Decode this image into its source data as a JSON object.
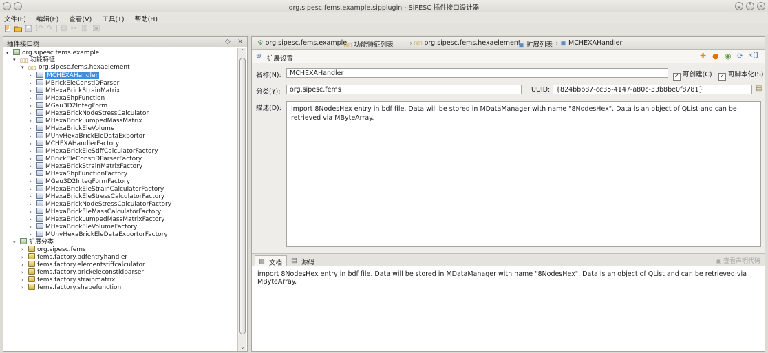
{
  "window": {
    "title": "org.sipesc.fems.example.sipplugin - SiPESC 插件接口设计器"
  },
  "menu": [
    "文件(F)",
    "编辑(E)",
    "查看(V)",
    "工具(T)",
    "帮助(H)"
  ],
  "left_panel": {
    "title": "插件接口树",
    "tree": {
      "root": "org.sipesc.fems.example",
      "group1": "功能特征",
      "package": "org.sipesc.fems.hexaelement",
      "classes": [
        "MCHEXAHandler",
        "MBrickEleConstiDParser",
        "MHexaBrickStrainMatrix",
        "MHexaShpFunction",
        "MGau3D2IntegForm",
        "MHexaBrickNodeStressCalculator",
        "MHexaBrickLumpedMassMatrix",
        "MHexaBrickEleVolume",
        "MUnvHexaBrickEleDataExportor",
        "MCHEXAHandlerFactory",
        "MHexaBrickEleStiffCalculatorFactory",
        "MBrickEleConstiDParserFactory",
        "MHexaBrickStrainMatrixFactory",
        "MHexaShpFunctionFactory",
        "MGau3D2IntegFormFactory",
        "MHexaBrickEleStrainCalculatorFactory",
        "MHexaBrickEleStressCalculatorFactory",
        "MHexaBrickNodeStressCalculatorFactory",
        "MHexaBrickEleMassCalculatorFactory",
        "MHexaBrickLumpedMassMatrixFactory",
        "MHexaBrickEleVolumeFactory",
        "MUnvHexaBrickEleDataExportorFactory"
      ],
      "group2": "扩展分类",
      "folders": [
        "org.sipesc.fems",
        "fems.factory.bdfentryhandler",
        "fems.factory.elementstiffcalculator",
        "fems.factory.brickeleconstidparser",
        "fems.factory.strainmatrix",
        "fems.factory.shapefunction"
      ]
    }
  },
  "breadcrumb": [
    "org.sipesc.fems.example",
    "功能特征列表",
    "org.sipesc.fems.hexaelement",
    "扩展列表",
    "MCHEXAHandler"
  ],
  "ext_settings": {
    "title": "扩展设置",
    "name_label": "名称(N):",
    "name_value": "MCHEXAHandler",
    "creatable_label": "可创建(C)",
    "scriptable_label": "可脚本化(S)",
    "category_label": "分类(Y):",
    "category_value": "org.sipesc.fems",
    "uuid_label": "UUID:",
    "uuid_value": "{824bbb87-cc35-4147-a80c-33b8be0f8781}",
    "desc_label": "描述(D):",
    "desc_value": "import 8NodesHex entry in bdf file. Data will be stored in MDataManager with name \"8NodesHex\". Data is an object of QList and can be retrieved via MByteArray."
  },
  "tabs": {
    "doc": "文档",
    "source": "源码",
    "view_decl": "查看声明代码"
  },
  "doc_text": "import 8NodesHex entry in bdf file. Data will be stored in MDataManager with name \"8NodesHex\". Data is an object of QList and can be retrieved via MByteArray."
}
